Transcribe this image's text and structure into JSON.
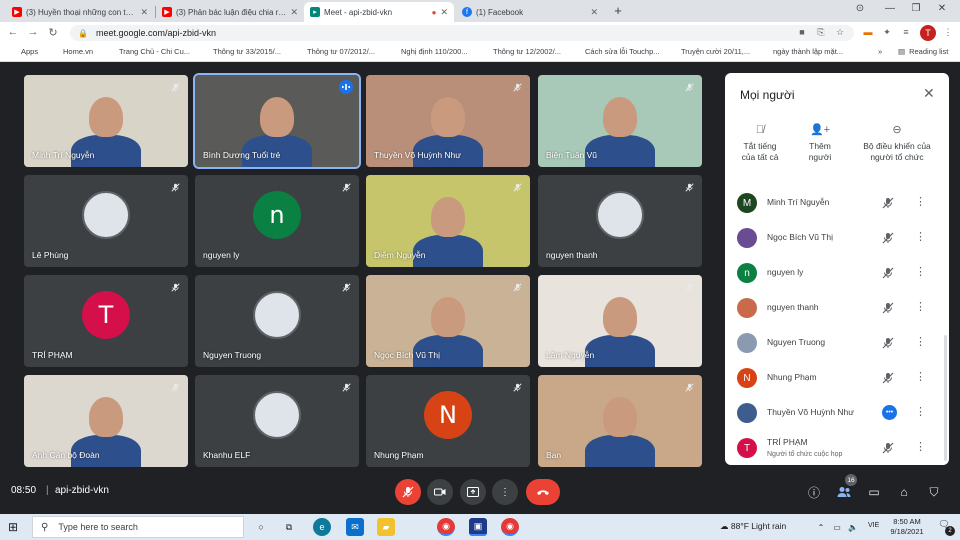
{
  "browser": {
    "tabs": [
      {
        "label": "(3) Huyền thoại những con tàu k",
        "icon": "youtube-icon",
        "active": false
      },
      {
        "label": "(3) Phản bác luận điệu chia rẽ vù",
        "icon": "youtube-icon",
        "active": false
      },
      {
        "label": "Meet - api-zbid-vkn",
        "icon": "meet-icon",
        "active": true
      },
      {
        "label": "(1) Facebook",
        "icon": "facebook-icon",
        "active": false
      }
    ],
    "url": "meet.google.com/api-zbid-vkn",
    "profile_initial": "T",
    "bookmarks": [
      {
        "label": "Apps",
        "color": "#4285f4"
      },
      {
        "label": "Home.vn",
        "color": "#34a853"
      },
      {
        "label": "Trang Chủ - Chi Cu...",
        "color": "#5f6368"
      },
      {
        "label": "Thông tư 33/2015/...",
        "color": "#c5221f"
      },
      {
        "label": "Thông tư 07/2012/...",
        "color": "#c5221f"
      },
      {
        "label": "Nghị định 110/200...",
        "color": "#c5221f"
      },
      {
        "label": "Thông tư 12/2002/...",
        "color": "#c5221f"
      },
      {
        "label": "Cách sửa lỗi Touchp...",
        "color": "#7b1fa2"
      },
      {
        "label": "Truyện cười 20/11,...",
        "color": "#e91e63"
      },
      {
        "label": "ngày thành lập mặt...",
        "color": "#4285f4"
      }
    ],
    "reading_list": "Reading list",
    "more_bookmarks": "»"
  },
  "meet": {
    "tiles": [
      {
        "name": "Minh Trí Nguyễn",
        "kind": "video",
        "bg": "#d9d4c8"
      },
      {
        "name": "Bình Dương Tuổi trẻ",
        "kind": "video",
        "bg": "#5a5a58",
        "speaking": true
      },
      {
        "name": "Thuyền Võ Huỳnh Như",
        "kind": "video",
        "bg": "#b98f7a"
      },
      {
        "name": "Biện Tuấn Vũ",
        "kind": "video",
        "bg": "#a8c9b8"
      },
      {
        "name": "Lê Phùng",
        "kind": "photo",
        "bg": "#3c4043"
      },
      {
        "name": "nguyen ly",
        "kind": "initial",
        "initial": "n",
        "color": "#0b8043"
      },
      {
        "name": "Diễm Nguyễn",
        "kind": "video",
        "bg": "#c7c56b"
      },
      {
        "name": "nguyen thanh",
        "kind": "photo",
        "bg": "#3c4043"
      },
      {
        "name": "TRÍ PHẠM",
        "kind": "initial",
        "initial": "T",
        "color": "#d50f4a"
      },
      {
        "name": "Nguyen Truong",
        "kind": "photo",
        "bg": "#3c4043"
      },
      {
        "name": "Ngọc Bích Vũ Thị",
        "kind": "video",
        "bg": "#c9b295"
      },
      {
        "name": "Lâm Nguyễn",
        "kind": "video",
        "bg": "#e8e3dc"
      },
      {
        "name": "Anh Cán bộ Đoàn",
        "kind": "video",
        "bg": "#dcd8d0"
      },
      {
        "name": "Khanhu ELF",
        "kind": "photo",
        "bg": "#3c4043"
      },
      {
        "name": "Nhung Phạm",
        "kind": "initial",
        "initial": "N",
        "color": "#d84315"
      },
      {
        "name": "Ban",
        "kind": "video",
        "bg": "#c8a888"
      }
    ],
    "panel": {
      "title": "Mọi người",
      "actions": [
        {
          "label_line1": "Tắt tiếng",
          "label_line2": "của tất cả",
          "icon": "mic-off-icon"
        },
        {
          "label_line1": "Thêm",
          "label_line2": "người",
          "icon": "person-add-icon"
        },
        {
          "label_line1": "Bộ điều khiển của",
          "label_line2": "người tổ chức",
          "icon": "host-controls-icon"
        }
      ],
      "participants": [
        {
          "name": "Minh Trí Nguyễn",
          "avatar": "M",
          "color": "#1e4620",
          "status": "muted"
        },
        {
          "name": "Ngọc Bích Vũ Thị",
          "avatar": "",
          "color": "#6a4c93",
          "status": "muted"
        },
        {
          "name": "nguyen ly",
          "avatar": "n",
          "color": "#0b8043",
          "status": "muted"
        },
        {
          "name": "nguyen thanh",
          "avatar": "",
          "color": "#c96a4a",
          "status": "muted"
        },
        {
          "name": "Nguyen Truong",
          "avatar": "",
          "color": "#8a9bb0",
          "status": "muted"
        },
        {
          "name": "Nhung Phạm",
          "avatar": "N",
          "color": "#d84315",
          "status": "muted"
        },
        {
          "name": "Thuyền Võ Huỳnh Như",
          "avatar": "",
          "color": "#3f5d8c",
          "status": "speaking"
        },
        {
          "name": "TRÍ PHẠM",
          "avatar": "T",
          "color": "#d50f4a",
          "status": "muted",
          "subtitle": "Người tổ chức cuộc họp"
        }
      ]
    },
    "bottom": {
      "time": "08:50",
      "separator": "|",
      "code": "api-zbid-vkn",
      "people_count": "16"
    }
  },
  "taskbar": {
    "search_placeholder": "Type here to search",
    "weather": "88°F  Light rain",
    "lang": "VIE",
    "time": "8:50 AM",
    "date": "9/18/2021",
    "notifications": "2"
  }
}
